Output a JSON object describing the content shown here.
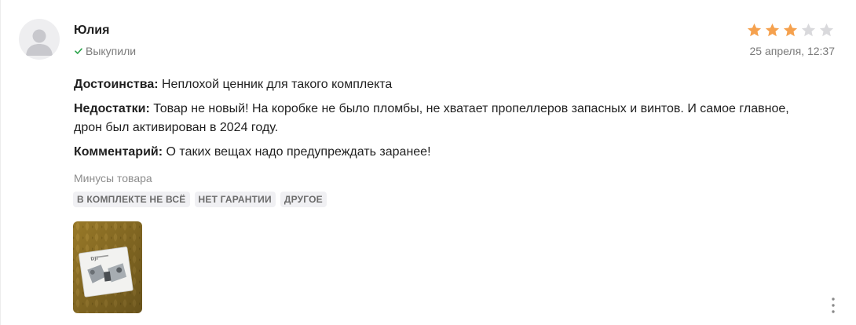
{
  "review": {
    "author": "Юлия",
    "verified_label": "Выкупили",
    "rating": 3,
    "rating_max": 5,
    "date": "25 апреля, 12:37",
    "pros_label": "Достоинства:",
    "pros_text": " Неплохой ценник для такого комплекта",
    "cons_label": "Недостатки:",
    "cons_text": " Товар не новый! На коробке не было пломбы, не хватает пропеллеров запасных и винтов. И самое главное, дрон был активирован в 2024 году.",
    "comment_label": "Комментарий:",
    "comment_text": " О таких вещах надо предупреждать заранее!",
    "minus_title": "Минусы товара",
    "tags": [
      "В КОМПЛЕКТЕ НЕ ВСЁ",
      "НЕТ ГАРАНТИИ",
      "ДРУГОЕ"
    ],
    "photo_box_brand": "DJI"
  },
  "icons": {
    "avatar": "user-avatar-icon",
    "verified": "check-icon",
    "star": "star-icon",
    "more": "more-vertical-icon"
  },
  "colors": {
    "star_filled": "#f5a14e",
    "star_empty": "#d9d9dc",
    "check": "#2aa34a",
    "tag_bg": "#f0f0f3"
  }
}
